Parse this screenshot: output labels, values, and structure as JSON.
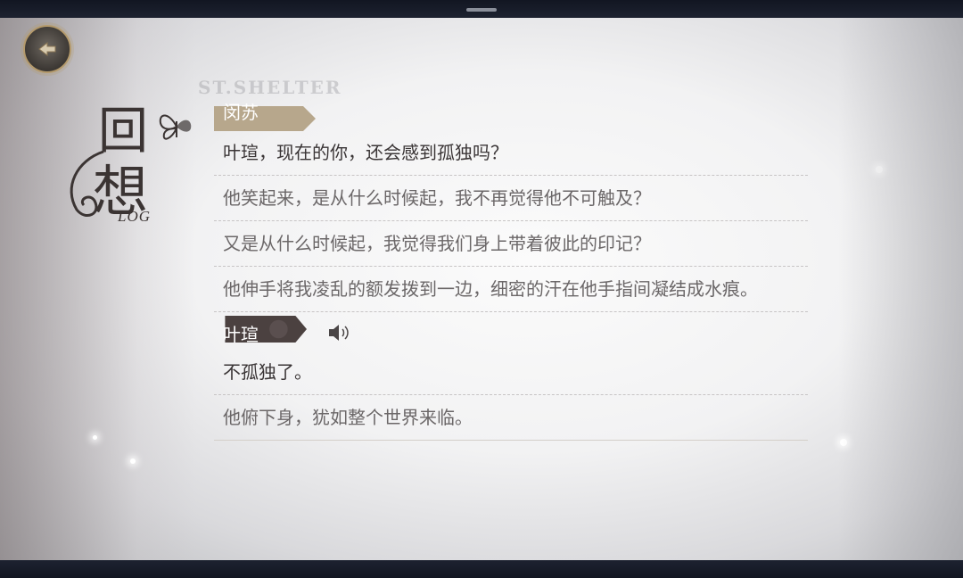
{
  "screen": {
    "watermark": "ST.SHELTER"
  },
  "title": {
    "char1": "回",
    "char2": "想",
    "sub": "LOG"
  },
  "colors": {
    "speaker_tag_top": "#b7a78c",
    "speaker_tag_active": "#4b4140",
    "text": "#5a5556"
  },
  "log": {
    "top_speaker": "闵苏",
    "lines_a": [
      "叶瑄，现在的你，还会感到孤独吗？",
      "他笑起来，是从什么时候起，我不再觉得他不可触及？",
      "又是从什么时候起，我觉得我们身上带着彼此的印记？",
      "他伸手将我凌乱的额发拨到一边，细密的汗在他手指间凝结成水痕。"
    ],
    "speaker2": "叶瑄",
    "lines_b": [
      "不孤独了。",
      "他俯下身，犹如整个世界来临。"
    ]
  },
  "icons": {
    "back": "back-emblem-icon",
    "voice": "speaker-icon",
    "butterfly": "butterfly-icon"
  }
}
